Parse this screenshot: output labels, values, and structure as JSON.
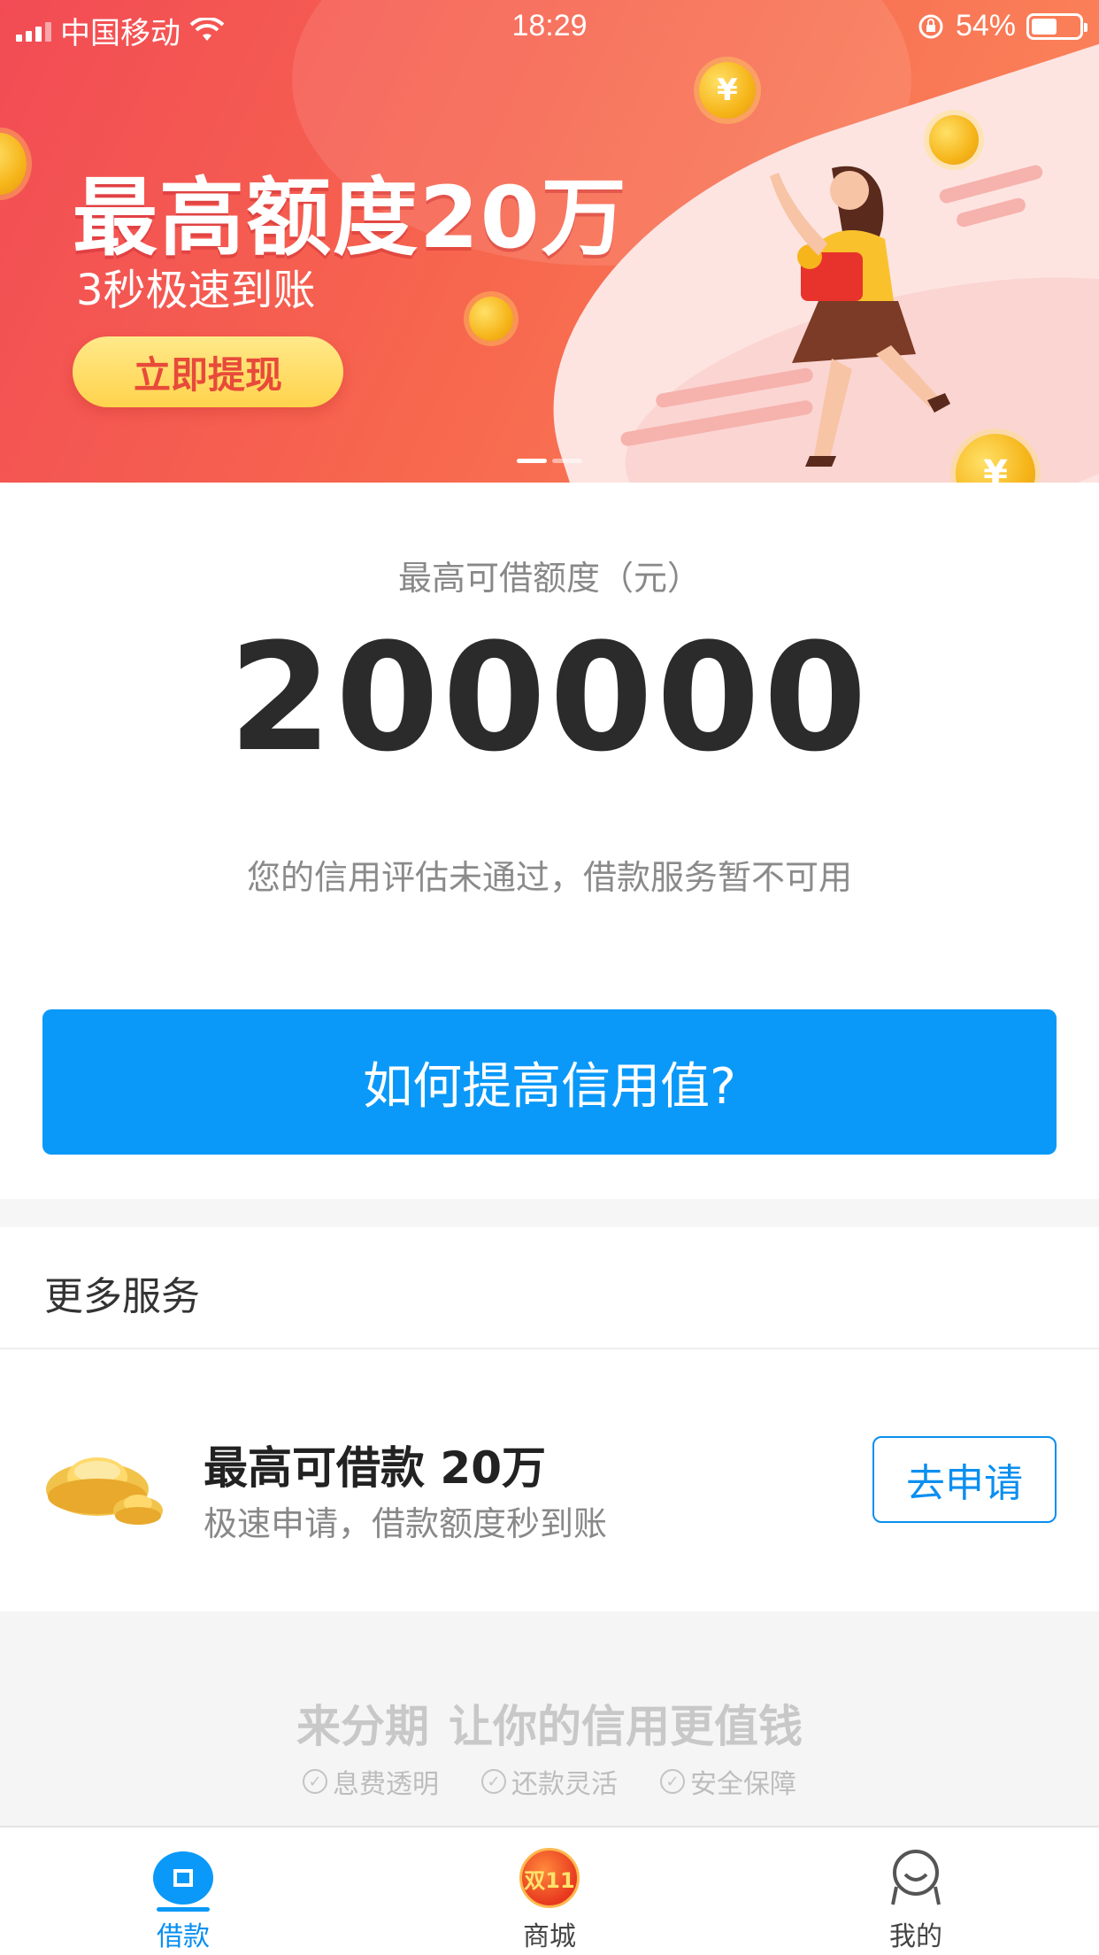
{
  "status_bar": {
    "carrier": "中国移动",
    "time": "18:29",
    "battery": "54%"
  },
  "banner": {
    "headline": "最高额度20万",
    "subheadline": "3秒极速到账",
    "cta_label": "立即提现",
    "coin_symbol": "¥",
    "slide_count": 2,
    "active_slide": 1
  },
  "credit": {
    "label": "最高可借额度（元）",
    "amount": "200000",
    "notice": "您的信用评估未通过，借款服务暂不可用",
    "button_label": "如何提高信用值?"
  },
  "more_services": {
    "title": "更多服务",
    "items": [
      {
        "title": "最高可借款 20万",
        "description": "极速申请，借款额度秒到账",
        "button_label": "去申请",
        "icon": "gold-ingot-icon"
      }
    ]
  },
  "slogan": {
    "brand": "来分期",
    "tagline": "让你的信用更值钱",
    "features": [
      "息费透明",
      "还款灵活",
      "安全保障"
    ]
  },
  "tabbar": {
    "tabs": [
      {
        "label": "借款",
        "icon": "loan-icon",
        "active": true
      },
      {
        "label": "商城",
        "icon": "double11-mall-icon",
        "badge_text": "双11",
        "active": false
      },
      {
        "label": "我的",
        "icon": "profile-icon",
        "active": false
      }
    ]
  },
  "colors": {
    "primary": "#0a99f8",
    "banner_red": "#f24b55",
    "banner_button": "#ffd34c",
    "text_dark": "#2b2b2b",
    "text_muted": "#888888"
  }
}
